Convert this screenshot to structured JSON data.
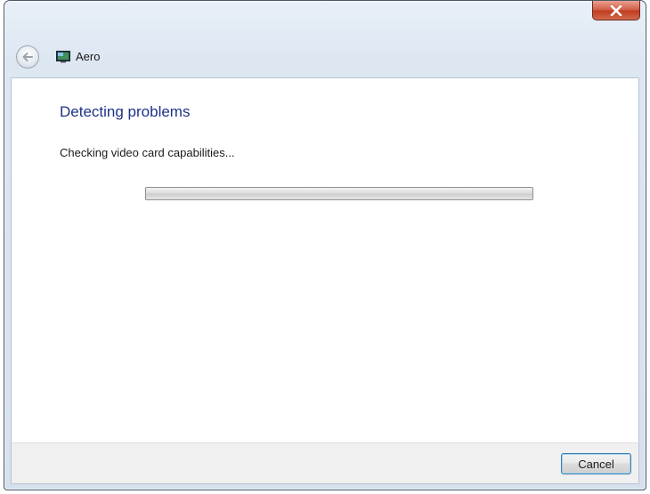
{
  "window": {
    "close_icon": "close-icon"
  },
  "nav": {
    "back_icon": "back-arrow-icon",
    "app_icon": "display-icon",
    "title": "Aero"
  },
  "main": {
    "heading": "Detecting problems",
    "status": "Checking video card capabilities...",
    "progress_fraction": 0
  },
  "footer": {
    "cancel_label": "Cancel"
  },
  "colors": {
    "heading": "#1e3287",
    "window_frame": "#d6e1ee",
    "close_button": "#c23d22"
  }
}
